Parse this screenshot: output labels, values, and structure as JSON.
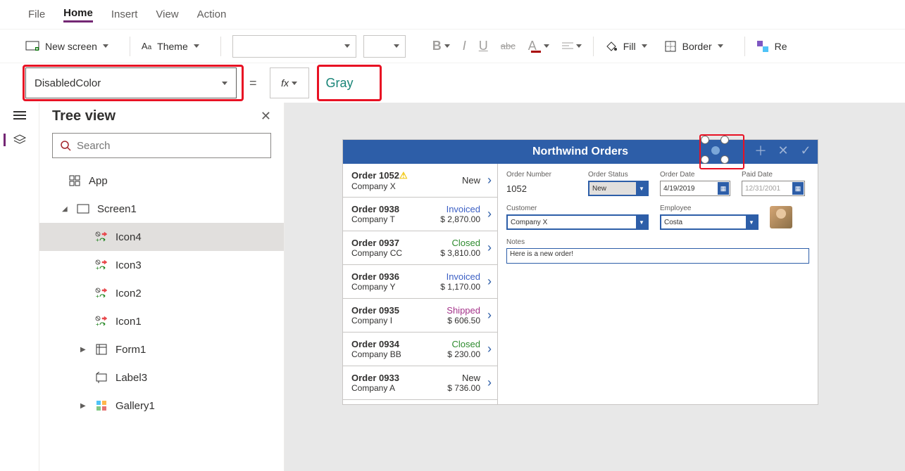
{
  "menu": {
    "file": "File",
    "home": "Home",
    "insert": "Insert",
    "view": "View",
    "action": "Action"
  },
  "toolbar": {
    "new_screen": "New screen",
    "theme": "Theme",
    "fill": "Fill",
    "border": "Border",
    "reorder": "Re"
  },
  "formula": {
    "property": "DisabledColor",
    "value": "Gray"
  },
  "tree": {
    "title": "Tree view",
    "search_placeholder": "Search",
    "app": "App",
    "screen1": "Screen1",
    "items": [
      {
        "name": "Icon4"
      },
      {
        "name": "Icon3"
      },
      {
        "name": "Icon2"
      },
      {
        "name": "Icon1"
      },
      {
        "name": "Form1"
      },
      {
        "name": "Label3"
      },
      {
        "name": "Gallery1"
      }
    ]
  },
  "app": {
    "title": "Northwind Orders",
    "orders": [
      {
        "title": "Order 1052",
        "company": "Company X",
        "status": "New",
        "amount": "",
        "warn": true
      },
      {
        "title": "Order 0938",
        "company": "Company T",
        "status": "Invoiced",
        "amount": "$ 2,870.00"
      },
      {
        "title": "Order 0937",
        "company": "Company CC",
        "status": "Closed",
        "amount": "$ 3,810.00"
      },
      {
        "title": "Order 0936",
        "company": "Company Y",
        "status": "Invoiced",
        "amount": "$ 1,170.00"
      },
      {
        "title": "Order 0935",
        "company": "Company I",
        "status": "Shipped",
        "amount": "$ 606.50"
      },
      {
        "title": "Order 0934",
        "company": "Company BB",
        "status": "Closed",
        "amount": "$ 230.00"
      },
      {
        "title": "Order 0933",
        "company": "Company A",
        "status": "New",
        "amount": "$ 736.00"
      }
    ],
    "detail": {
      "order_number_label": "Order Number",
      "order_number": "1052",
      "order_status_label": "Order Status",
      "order_status": "New",
      "order_date_label": "Order Date",
      "order_date": "4/19/2019",
      "paid_date_label": "Paid Date",
      "paid_date": "12/31/2001",
      "customer_label": "Customer",
      "customer": "Company X",
      "employee_label": "Employee",
      "employee": "Costa",
      "notes_label": "Notes",
      "notes": "Here is a new order!"
    }
  }
}
